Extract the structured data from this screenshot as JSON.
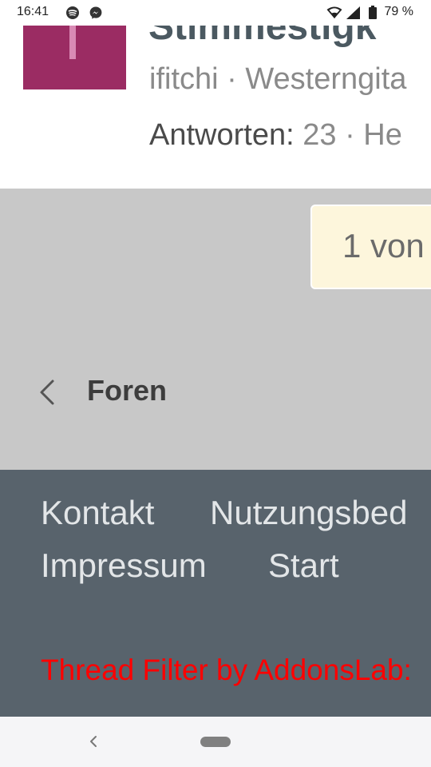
{
  "status_bar": {
    "time": "16:41",
    "app_icons": [
      "spotify-icon",
      "messenger-icon"
    ],
    "system_icons": [
      "wifi-icon",
      "signal-icon",
      "battery-icon"
    ],
    "battery": "79 %"
  },
  "thread": {
    "title": "Stimmestigk",
    "author": "ifitchi",
    "separator": "·",
    "forum": "Westerngita",
    "replies_label": "Antworten:",
    "replies_count": "23",
    "stats_rest": "He"
  },
  "pagination": {
    "text": "1 von"
  },
  "breadcrumb": {
    "label": "Foren",
    "icon": "chevron-left-icon"
  },
  "footer": {
    "links": [
      "Kontakt",
      "Nutzungsbed",
      "Impressum",
      "Start"
    ],
    "credit": "Thread Filter by AddonsLab:"
  },
  "colors": {
    "avatar": "#9b2c63",
    "footer_bg": "#58636c",
    "gray_bg": "#c8c8c8",
    "pagination_bg": "#fdf6dc",
    "credit_red": "#ff0000"
  }
}
